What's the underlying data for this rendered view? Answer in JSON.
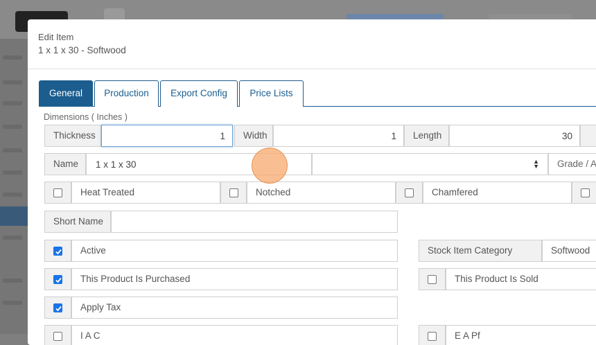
{
  "modal": {
    "title": "Edit Item",
    "subtitle": "1 x 1 x 30 - Softwood"
  },
  "tabs": [
    {
      "label": "General",
      "active": true
    },
    {
      "label": "Production",
      "active": false
    },
    {
      "label": "Export Config",
      "active": false
    },
    {
      "label": "Price Lists",
      "active": false
    }
  ],
  "dimensions": {
    "label": "Dimensions ( Inches )",
    "thickness_label": "Thickness",
    "thickness_value": "1",
    "width_label": "Width",
    "width_value": "1",
    "length_label": "Length",
    "length_value": "30"
  },
  "name": {
    "label": "Name",
    "value": "1 x 1 x 30",
    "grade_label": "Grade / A"
  },
  "treatments": {
    "heat_treated": "Heat Treated",
    "notched": "Notched",
    "chamfered": "Chamfered"
  },
  "short_name": {
    "label": "Short Name",
    "value": ""
  },
  "flags": {
    "active": "Active",
    "purchased": "This Product Is Purchased",
    "apply_tax": "Apply Tax",
    "sold": "This Product Is Sold",
    "row5_left": "I A C",
    "row5_right": "E A Pf"
  },
  "stock_category": {
    "label": "Stock Item Category",
    "value": "Softwood"
  },
  "icons": {
    "select": "select-arrows-icon",
    "checkmark": "checkmark-icon"
  },
  "colors": {
    "accent": "#1b5d8f",
    "checkbox": "#1a73e8",
    "cursor": "#f7aa6e"
  }
}
